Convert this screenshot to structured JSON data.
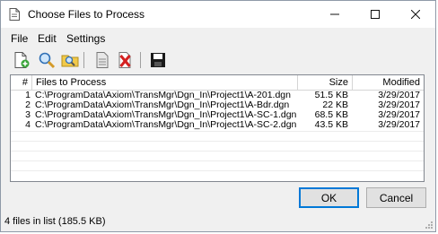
{
  "window": {
    "title": "Choose Files to Process",
    "controls": {
      "minimize": "—",
      "maximize": "☐",
      "close": "✕"
    }
  },
  "menu": [
    "File",
    "Edit",
    "Settings"
  ],
  "toolbar": {
    "icons": [
      "add-file-icon",
      "search-icon",
      "find-in-folder-icon",
      "properties-icon",
      "delete-file-icon",
      "save-icon"
    ]
  },
  "table": {
    "headers": {
      "num": "#",
      "file": "Files to Process",
      "size": "Size",
      "modified": "Modified"
    },
    "rows": [
      {
        "num": "1",
        "file": "C:\\ProgramData\\Axiom\\TransMgr\\Dgn_In\\Project1\\A-201.dgn",
        "size": "51.5 KB",
        "modified": "3/29/2017"
      },
      {
        "num": "2",
        "file": "C:\\ProgramData\\Axiom\\TransMgr\\Dgn_In\\Project1\\A-Bdr.dgn",
        "size": "22 KB",
        "modified": "3/29/2017"
      },
      {
        "num": "3",
        "file": "C:\\ProgramData\\Axiom\\TransMgr\\Dgn_In\\Project1\\A-SC-1.dgn",
        "size": "68.5 KB",
        "modified": "3/29/2017"
      },
      {
        "num": "4",
        "file": "C:\\ProgramData\\Axiom\\TransMgr\\Dgn_In\\Project1\\A-SC-2.dgn",
        "size": "43.5 KB",
        "modified": "3/29/2017"
      }
    ]
  },
  "buttons": {
    "ok": "OK",
    "cancel": "Cancel"
  },
  "status": "4 files in list (185.5 KB)",
  "colors": {
    "accent": "#0078d7",
    "delete_red": "#d42020",
    "save_dark": "#1a1a1a"
  }
}
